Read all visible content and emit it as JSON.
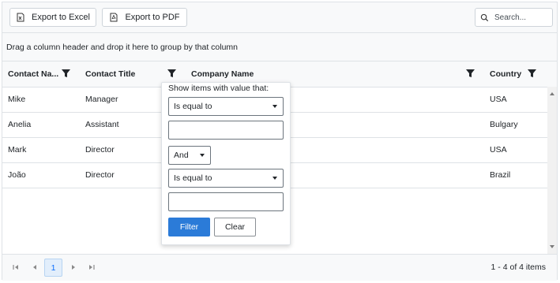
{
  "toolbar": {
    "export_excel": "Export to Excel",
    "export_pdf": "Export to PDF",
    "search_placeholder": "Search..."
  },
  "group_panel": {
    "hint": "Drag a column header and drop it here to group by that column"
  },
  "columns": [
    {
      "label": "Contact Na..."
    },
    {
      "label": "Contact Title"
    },
    {
      "label": "Company Name"
    },
    {
      "label": "Country"
    }
  ],
  "rows": [
    {
      "contact_name": "Mike",
      "contact_title": "Manager",
      "company_name": "",
      "country": "USA"
    },
    {
      "contact_name": "Anelia",
      "contact_title": "Assistant",
      "company_name": "",
      "country": "Bulgary"
    },
    {
      "contact_name": "Mark",
      "contact_title": "Director",
      "company_name": "",
      "country": "USA"
    },
    {
      "contact_name": "João",
      "contact_title": "Director",
      "company_name": "",
      "country": "Brazil"
    }
  ],
  "filter_popup": {
    "title": "Show items with value that:",
    "operator1": "Is equal to",
    "value1": "",
    "logic": "And",
    "operator2": "Is equal to",
    "value2": "",
    "filter_label": "Filter",
    "clear_label": "Clear"
  },
  "pager": {
    "current_page": "1",
    "info": "1 - 4 of 4 items"
  },
  "colors": {
    "accent": "#2b7bd8",
    "border": "#dee2e6",
    "header_bg": "#f8f9fa"
  }
}
